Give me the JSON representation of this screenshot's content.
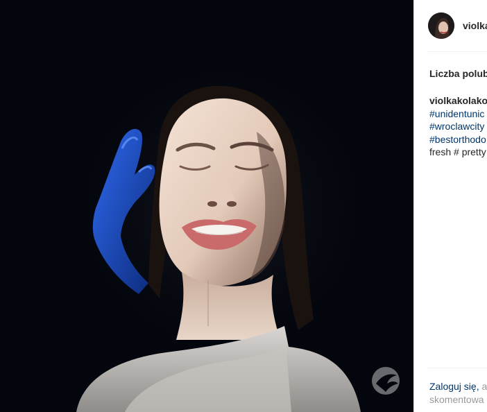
{
  "post": {
    "photo": {
      "alt": "",
      "watermark_icon": "bird-logo-icon",
      "watermark_text": "",
      "colors": {
        "background": "#04060d",
        "glove": "#1f4fd6",
        "skin": "#e8d2c2"
      }
    }
  },
  "sidebar": {
    "username": "violka",
    "likes_label": "Liczba polub",
    "caption": {
      "author": "violkakolako",
      "hashtags": [
        "#unidentunic",
        "#wroclawcity",
        "#bestorthodo"
      ],
      "tail": "fresh # pretty"
    },
    "login": {
      "link_text": "Zaloguj się,",
      "rest_text": " a",
      "line2": "skomentowa"
    }
  },
  "colors": {
    "link": "#003569",
    "text": "#262626",
    "muted": "#999999",
    "divider": "#efefef"
  }
}
